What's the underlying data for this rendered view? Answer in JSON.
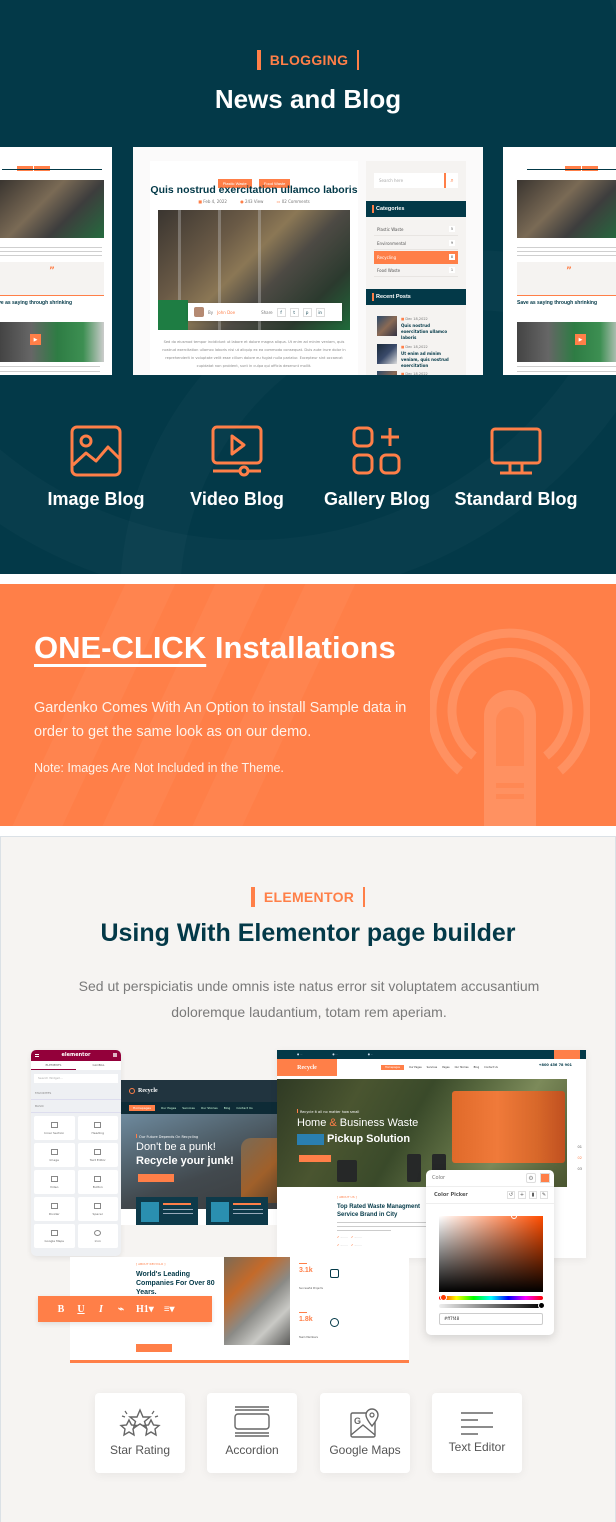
{
  "colors": {
    "navy": "#033948",
    "orange": "#ff7f48",
    "light_bg": "#f6f4f2",
    "elementor_brand": "#93003a"
  },
  "blog_section": {
    "tag": "BLOGGING",
    "title": "News and Blog",
    "preview_center": {
      "post_tags": [
        "Plastic Waste",
        "Food Waste"
      ],
      "post_title": "Quis nostrud exercitation ullamco laboris",
      "meta": {
        "date": "Feb 4, 2022",
        "views": "243 View",
        "comments": "02 Comments"
      },
      "author_prefix": "By",
      "author_name": "John Doe",
      "share_label": "Share",
      "share_icons": [
        "f",
        "t",
        "p",
        "in"
      ],
      "excerpt": "Sed do eiusmod tempor incididunt ut labore et dolore magna aliqua. Ut enim ad minim veniam, quis nostrud exercitation ullamco laboris nisi ut aliquip ex ea commodo consequat. Duis aute irure dolor in reprehenderit in voluptate velit esse cillum dolore eu fugiat nulla pariatur. Excepteur sint occaecat cupidatat non proident, sunt in culpa qui officia deserunt mollit.",
      "sidebar": {
        "search_placeholder": "Search here",
        "categories_title": "Categories",
        "categories": [
          {
            "name": "Plastic Waste",
            "count": "5",
            "active": false
          },
          {
            "name": "Environmental",
            "count": "9",
            "active": false
          },
          {
            "name": "Recycling",
            "count": "8",
            "active": true
          },
          {
            "name": "Food Waste",
            "count": "1",
            "active": false
          }
        ],
        "recent_title": "Recent Posts",
        "recent_posts": [
          {
            "date": "Dec 18,2022",
            "title": "Quis nostrud exercitation ullamco laboris"
          },
          {
            "date": "Dec 18,2022",
            "title": "Ut enim ad minim veniam, quis nostrud exercitation"
          },
          {
            "date": "Dec 18,2022",
            "title": ""
          }
        ]
      }
    },
    "preview_side": {
      "quote_mark": "”",
      "heading": "Save as saying through shrinking"
    },
    "blog_types": [
      {
        "label": "Image Blog",
        "icon": "image-icon"
      },
      {
        "label": "Video Blog",
        "icon": "video-icon"
      },
      {
        "label": "Gallery Blog",
        "icon": "gallery-icon"
      },
      {
        "label": "Standard Blog",
        "icon": "monitor-icon"
      }
    ]
  },
  "oneclick_section": {
    "title_highlight": "ONE-CLICK",
    "title_rest": " Installations",
    "description": "Gardenko Comes With An Option to install Sample data in order to get the same look as on our demo.",
    "note": "Note: Images Are Not Included in the Theme."
  },
  "elementor_section": {
    "tag": "ELEMENTOR",
    "title": "Using With Elementor page builder",
    "description": "Sed ut perspiciatis unde omnis iste natus error sit voluptatem accusantium doloremque laudantium, totam rem aperiam.",
    "panel": {
      "brand": "elementor",
      "tabs": [
        "ELEMENTS",
        "GLOBAL"
      ],
      "search_placeholder": "Search Widget...",
      "groups": [
        "FAVORITES",
        "BASIC"
      ],
      "widgets": [
        "Inner Section",
        "Heading",
        "Image",
        "Text Editor",
        "Video",
        "Button",
        "Divider",
        "Spacer",
        "Google Maps",
        "Icon"
      ]
    },
    "site1": {
      "logo": "Recycle",
      "nav": [
        "Homepages",
        "Our Pages",
        "Services",
        "Our Stories",
        "Blog",
        "Contact Us"
      ],
      "hero_small": "Our Future Depends On Recycling",
      "hero_line1": "Don't be a punk!",
      "hero_line2": "Recycle your junk!"
    },
    "site2": {
      "logo": "Recycle",
      "nav": [
        "Homepages",
        "Our Pages",
        "Services",
        "Pages",
        "Our Stories",
        "Blog",
        "Contact Us"
      ],
      "phone": "+800 456 78 901",
      "hero_small": "Recycle it all no matter how small",
      "hero_line1_a": "Home ",
      "hero_line1_amp": "&",
      "hero_line1_b": " Business Waste",
      "hero_line2": "Pickup Solution",
      "side_numbers": [
        "01",
        "02",
        "03"
      ],
      "about_tag": "[ ABOUT US ]",
      "about_title": "Top Rated Waste Managment Service Brand in City"
    },
    "color_picker": {
      "label": "Color",
      "title": "Color Picker",
      "hex_value": "#ff7f48",
      "selected_color": "#ff7f48"
    },
    "site3": {
      "tag": "[ ABOUT RECYCLO ]",
      "title": "World's Leading Companies For Over 80 Years.",
      "stats": [
        {
          "value": "3.1k",
          "label": "Successful Projects"
        },
        {
          "value": "1.8k",
          "label": "Team Members"
        }
      ]
    },
    "text_toolbar": [
      "B",
      "U",
      "I",
      "⌁",
      "H1▾",
      "≡▾"
    ],
    "widget_cards": [
      {
        "label": "Star Rating",
        "icon": "star-rating-icon"
      },
      {
        "label": "Accordion",
        "icon": "accordion-icon"
      },
      {
        "label": "Google Maps",
        "icon": "google-maps-icon"
      },
      {
        "label": "Text Editor",
        "icon": "text-editor-icon"
      }
    ]
  }
}
